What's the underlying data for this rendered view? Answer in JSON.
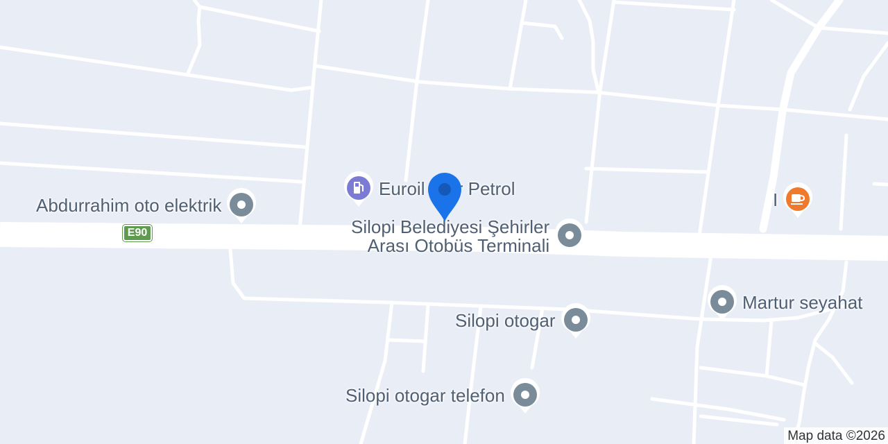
{
  "map": {
    "route_shield": "E90",
    "attribution": "Map data ©2026",
    "colors": {
      "background": "#e9edf6",
      "road": "#ffffff",
      "poi_generic": "#7a8b99",
      "poi_fuel": "#7b7bd4",
      "poi_cafe": "#f07a2b",
      "selected_marker": "#1a73e8"
    },
    "pois": [
      {
        "name": "Abdurrahim oto elektrik",
        "icon": "generic-place-icon"
      },
      {
        "name": "Euroil Star Petrol",
        "icon": "gas-station-icon"
      },
      {
        "name_line1": "Silopi Belediyesi Şehirler",
        "name_line2": "Arası Otobüs Terminali",
        "icon": "generic-place-icon"
      },
      {
        "name": "Silopi otogar",
        "icon": "generic-place-icon"
      },
      {
        "name": "Martur seyahat",
        "icon": "generic-place-icon"
      },
      {
        "name": "Silopi otogar telefon",
        "icon": "generic-place-icon"
      },
      {
        "name": "I",
        "icon": "cafe-icon"
      }
    ],
    "selected_marker_icon": "red-pin-icon"
  }
}
